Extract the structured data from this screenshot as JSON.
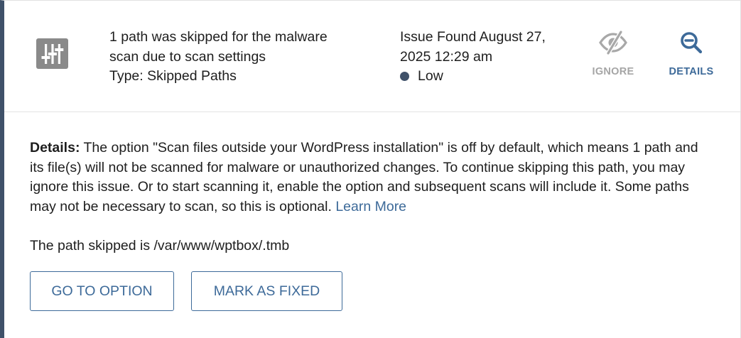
{
  "issue": {
    "icon": "sliders-icon",
    "title_line1": "1 path was skipped for the malware",
    "title_line2": "scan due to scan settings",
    "type_text": "Type: Skipped Paths",
    "found_line1": "Issue Found August 27,",
    "found_line2": "2025 12:29 am",
    "severity": "Low",
    "severity_color": "#3f5169"
  },
  "actions": {
    "ignore_label": "IGNORE",
    "ignore_icon": "eye-slash-icon",
    "details_label": "DETAILS",
    "details_icon": "magnifier-minus-icon"
  },
  "details": {
    "label": "Details:",
    "text": " The option \"Scan files outside your WordPress installation\" is off by default, which means 1 path and its file(s) will not be scanned for malware or unauthorized changes. To continue skipping this path, you may ignore this issue. Or to start scanning it, enable the option and subsequent scans will include it. Some paths may not be necessary to scan, so this is optional. ",
    "learn_more": "Learn More",
    "path_text": "The path skipped is /var/www/wptbox/.tmb"
  },
  "buttons": {
    "go_to_option": "GO TO OPTION",
    "mark_as_fixed": "MARK AS FIXED"
  },
  "colors": {
    "accent": "#3d6a99",
    "left_border": "#3f5169",
    "muted": "#a5a5a5",
    "icon_bg": "#8a8a8a"
  }
}
